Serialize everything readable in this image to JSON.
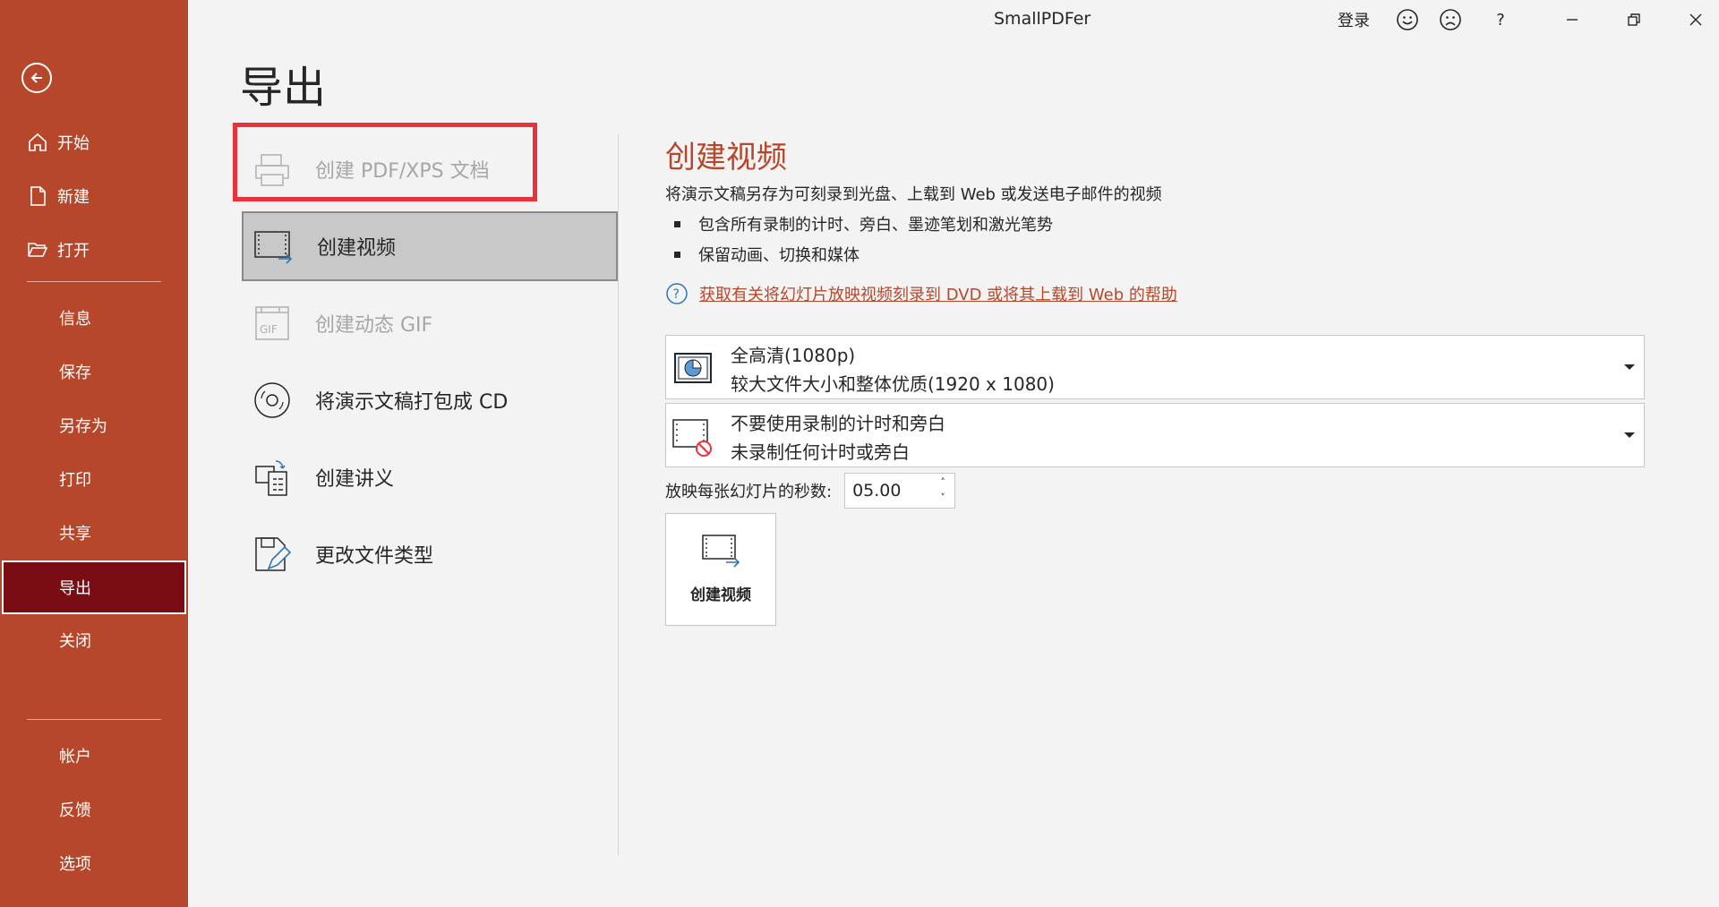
{
  "app": {
    "title": "SmallPDFer"
  },
  "titlebar": {
    "signin": "登录",
    "help": "?",
    "icons": [
      "smile-icon",
      "frown-icon",
      "help-icon",
      "minimize-icon",
      "restore-icon",
      "close-icon"
    ]
  },
  "sidebar": {
    "back_icon": "back-arrow-icon",
    "top_items": [
      {
        "label": "开始",
        "icon": "home-icon"
      },
      {
        "label": "新建",
        "icon": "new-document-icon"
      },
      {
        "label": "打开",
        "icon": "open-folder-icon"
      }
    ],
    "middle_items": [
      {
        "label": "信息"
      },
      {
        "label": "保存"
      },
      {
        "label": "另存为"
      },
      {
        "label": "打印"
      },
      {
        "label": "共享"
      },
      {
        "label": "导出",
        "active": true
      },
      {
        "label": "关闭"
      }
    ],
    "bottom_items": [
      {
        "label": "帐户"
      },
      {
        "label": "反馈"
      },
      {
        "label": "选项"
      }
    ]
  },
  "page": {
    "title": "导出"
  },
  "export_options": [
    {
      "label": "创建 PDF/XPS 文档",
      "icon": "pdf-printer-icon",
      "disabled": true,
      "highlighted": true
    },
    {
      "label": "创建视频",
      "icon": "video-film-icon",
      "selected": true
    },
    {
      "label": "创建动态 GIF",
      "icon": "gif-icon",
      "disabled": true
    },
    {
      "label": "将演示文稿打包成 CD",
      "icon": "cd-icon"
    },
    {
      "label": "创建讲义",
      "icon": "handout-icon"
    },
    {
      "label": "更改文件类型",
      "icon": "change-file-type-icon"
    }
  ],
  "content": {
    "title": "创建视频",
    "description": "将演示文稿另存为可刻录到光盘、上载到 Web 或发送电子邮件的视频",
    "bullets": [
      "包含所有录制的计时、旁白、墨迹笔划和激光笔势",
      "保留动画、切换和媒体"
    ],
    "help_link": "获取有关将幻灯片放映视频刻录到 DVD 或将其上载到 Web 的帮助",
    "quality_dropdown": {
      "title": "全高清(1080p)",
      "subtitle": "较大文件大小和整体优质(1920 x 1080)",
      "icon": "presentation-quality-icon"
    },
    "timing_dropdown": {
      "title": "不要使用录制的计时和旁白",
      "subtitle": "未录制任何计时或旁白",
      "icon": "no-timing-icon"
    },
    "seconds_label": "放映每张幻灯片的秒数:",
    "seconds_value": "05.00",
    "create_button": "创建视频"
  },
  "colors": {
    "accent": "#b7472a",
    "active_nav": "#7a0d13",
    "highlight": "#e8323c"
  }
}
